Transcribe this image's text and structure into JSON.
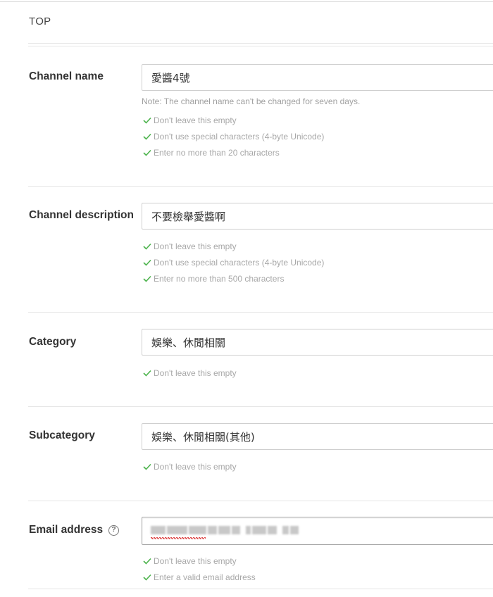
{
  "breadcrumb": "TOP",
  "icons": {
    "check": "check-icon",
    "help": "help-circle-icon"
  },
  "colors": {
    "check": "#4cb34c",
    "rule_text": "#a8a8a8",
    "label_text": "#333333"
  },
  "channel_name": {
    "label": "Channel name",
    "value": "愛醬4號",
    "note": "Note: The channel name can't be changed for seven days.",
    "rules": [
      "Don't leave this empty",
      "Don't use special characters (4-byte Unicode)",
      "Enter no more than 20 characters"
    ]
  },
  "channel_description": {
    "label": "Channel description",
    "value": "不要檢舉愛醬啊",
    "rules": [
      "Don't leave this empty",
      "Don't use special characters (4-byte Unicode)",
      "Enter no more than 500 characters"
    ]
  },
  "category": {
    "label": "Category",
    "value": "娛樂、休閒相關",
    "rules": [
      "Don't leave this empty"
    ]
  },
  "subcategory": {
    "label": "Subcategory",
    "value": "娛樂、休閒相關(其他)",
    "rules": [
      "Don't leave this empty"
    ]
  },
  "email_address": {
    "label": "Email address",
    "help_icon_glyph": "?",
    "value_redacted": true,
    "rules": [
      "Don't leave this empty",
      "Enter a valid email address"
    ]
  }
}
